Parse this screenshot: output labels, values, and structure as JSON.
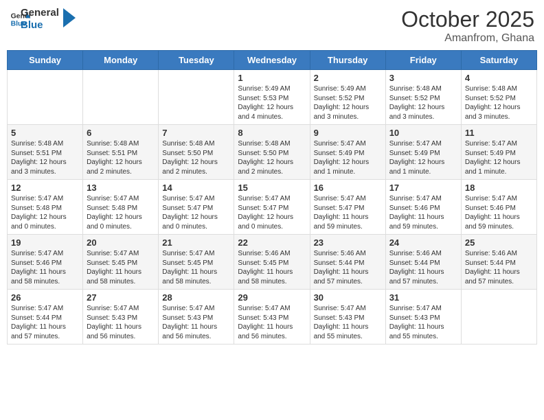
{
  "header": {
    "logo_line1": "General",
    "logo_line2": "Blue",
    "month": "October 2025",
    "location": "Amanfrom, Ghana"
  },
  "days_of_week": [
    "Sunday",
    "Monday",
    "Tuesday",
    "Wednesday",
    "Thursday",
    "Friday",
    "Saturday"
  ],
  "weeks": [
    [
      {
        "num": "",
        "detail": ""
      },
      {
        "num": "",
        "detail": ""
      },
      {
        "num": "",
        "detail": ""
      },
      {
        "num": "1",
        "detail": "Sunrise: 5:49 AM\nSunset: 5:53 PM\nDaylight: 12 hours\nand 4 minutes."
      },
      {
        "num": "2",
        "detail": "Sunrise: 5:49 AM\nSunset: 5:52 PM\nDaylight: 12 hours\nand 3 minutes."
      },
      {
        "num": "3",
        "detail": "Sunrise: 5:48 AM\nSunset: 5:52 PM\nDaylight: 12 hours\nand 3 minutes."
      },
      {
        "num": "4",
        "detail": "Sunrise: 5:48 AM\nSunset: 5:52 PM\nDaylight: 12 hours\nand 3 minutes."
      }
    ],
    [
      {
        "num": "5",
        "detail": "Sunrise: 5:48 AM\nSunset: 5:51 PM\nDaylight: 12 hours\nand 3 minutes."
      },
      {
        "num": "6",
        "detail": "Sunrise: 5:48 AM\nSunset: 5:51 PM\nDaylight: 12 hours\nand 2 minutes."
      },
      {
        "num": "7",
        "detail": "Sunrise: 5:48 AM\nSunset: 5:50 PM\nDaylight: 12 hours\nand 2 minutes."
      },
      {
        "num": "8",
        "detail": "Sunrise: 5:48 AM\nSunset: 5:50 PM\nDaylight: 12 hours\nand 2 minutes."
      },
      {
        "num": "9",
        "detail": "Sunrise: 5:47 AM\nSunset: 5:49 PM\nDaylight: 12 hours\nand 1 minute."
      },
      {
        "num": "10",
        "detail": "Sunrise: 5:47 AM\nSunset: 5:49 PM\nDaylight: 12 hours\nand 1 minute."
      },
      {
        "num": "11",
        "detail": "Sunrise: 5:47 AM\nSunset: 5:49 PM\nDaylight: 12 hours\nand 1 minute."
      }
    ],
    [
      {
        "num": "12",
        "detail": "Sunrise: 5:47 AM\nSunset: 5:48 PM\nDaylight: 12 hours\nand 0 minutes."
      },
      {
        "num": "13",
        "detail": "Sunrise: 5:47 AM\nSunset: 5:48 PM\nDaylight: 12 hours\nand 0 minutes."
      },
      {
        "num": "14",
        "detail": "Sunrise: 5:47 AM\nSunset: 5:47 PM\nDaylight: 12 hours\nand 0 minutes."
      },
      {
        "num": "15",
        "detail": "Sunrise: 5:47 AM\nSunset: 5:47 PM\nDaylight: 12 hours\nand 0 minutes."
      },
      {
        "num": "16",
        "detail": "Sunrise: 5:47 AM\nSunset: 5:47 PM\nDaylight: 11 hours\nand 59 minutes."
      },
      {
        "num": "17",
        "detail": "Sunrise: 5:47 AM\nSunset: 5:46 PM\nDaylight: 11 hours\nand 59 minutes."
      },
      {
        "num": "18",
        "detail": "Sunrise: 5:47 AM\nSunset: 5:46 PM\nDaylight: 11 hours\nand 59 minutes."
      }
    ],
    [
      {
        "num": "19",
        "detail": "Sunrise: 5:47 AM\nSunset: 5:46 PM\nDaylight: 11 hours\nand 58 minutes."
      },
      {
        "num": "20",
        "detail": "Sunrise: 5:47 AM\nSunset: 5:45 PM\nDaylight: 11 hours\nand 58 minutes."
      },
      {
        "num": "21",
        "detail": "Sunrise: 5:47 AM\nSunset: 5:45 PM\nDaylight: 11 hours\nand 58 minutes."
      },
      {
        "num": "22",
        "detail": "Sunrise: 5:46 AM\nSunset: 5:45 PM\nDaylight: 11 hours\nand 58 minutes."
      },
      {
        "num": "23",
        "detail": "Sunrise: 5:46 AM\nSunset: 5:44 PM\nDaylight: 11 hours\nand 57 minutes."
      },
      {
        "num": "24",
        "detail": "Sunrise: 5:46 AM\nSunset: 5:44 PM\nDaylight: 11 hours\nand 57 minutes."
      },
      {
        "num": "25",
        "detail": "Sunrise: 5:46 AM\nSunset: 5:44 PM\nDaylight: 11 hours\nand 57 minutes."
      }
    ],
    [
      {
        "num": "26",
        "detail": "Sunrise: 5:47 AM\nSunset: 5:44 PM\nDaylight: 11 hours\nand 57 minutes."
      },
      {
        "num": "27",
        "detail": "Sunrise: 5:47 AM\nSunset: 5:43 PM\nDaylight: 11 hours\nand 56 minutes."
      },
      {
        "num": "28",
        "detail": "Sunrise: 5:47 AM\nSunset: 5:43 PM\nDaylight: 11 hours\nand 56 minutes."
      },
      {
        "num": "29",
        "detail": "Sunrise: 5:47 AM\nSunset: 5:43 PM\nDaylight: 11 hours\nand 56 minutes."
      },
      {
        "num": "30",
        "detail": "Sunrise: 5:47 AM\nSunset: 5:43 PM\nDaylight: 11 hours\nand 55 minutes."
      },
      {
        "num": "31",
        "detail": "Sunrise: 5:47 AM\nSunset: 5:43 PM\nDaylight: 11 hours\nand 55 minutes."
      },
      {
        "num": "",
        "detail": ""
      }
    ]
  ]
}
